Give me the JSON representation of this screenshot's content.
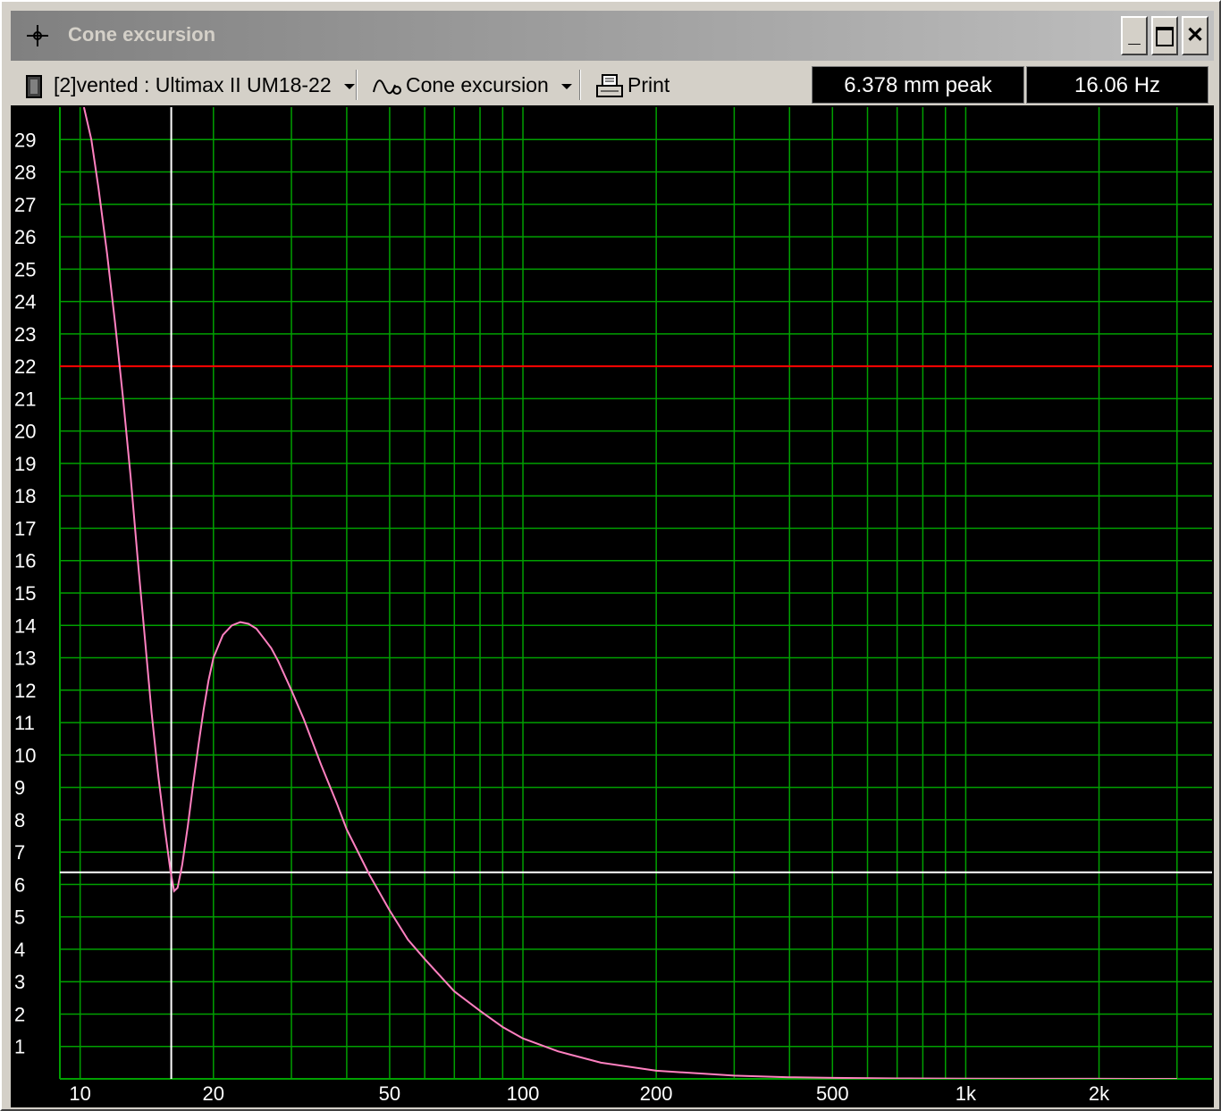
{
  "window": {
    "title": "Cone excursion",
    "icons": {
      "app": "crosshair-icon",
      "minimize": "minimize-icon",
      "maximize": "maximize-icon",
      "close": "close-icon"
    },
    "minimize_glyph": "_",
    "close_glyph": "✕"
  },
  "toolbar": {
    "project_select": {
      "value": "[2]vented : Ultimax II UM18-22",
      "icon": "speaker-icon"
    },
    "graph_select": {
      "value": "Cone excursion",
      "icon": "waveform-icon"
    },
    "print_label": "Print",
    "print_icon": "printer-icon"
  },
  "readouts": {
    "excursion": "6.378 mm peak",
    "frequency": "16.06 Hz"
  },
  "colors": {
    "grid": "#00a000",
    "curve": "#ff80c0",
    "limit_line": "#ff0000",
    "cursor": "#ffffff",
    "tick_text": "#ffffff",
    "background": "#000000"
  },
  "chart_data": {
    "type": "line",
    "x_scale": "log",
    "xlim": [
      9,
      3600
    ],
    "ylim": [
      0,
      30
    ],
    "grid": true,
    "x_tick_labels": [
      {
        "value": 10,
        "label": "10"
      },
      {
        "value": 20,
        "label": "20"
      },
      {
        "value": 50,
        "label": "50"
      },
      {
        "value": 100,
        "label": "100"
      },
      {
        "value": 200,
        "label": "200"
      },
      {
        "value": 500,
        "label": "500"
      },
      {
        "value": 1000,
        "label": "1k"
      },
      {
        "value": 2000,
        "label": "2k"
      }
    ],
    "y_ticks": [
      1,
      2,
      3,
      4,
      5,
      6,
      7,
      8,
      9,
      10,
      11,
      12,
      13,
      14,
      15,
      16,
      17,
      18,
      19,
      20,
      21,
      22,
      23,
      24,
      25,
      26,
      27,
      28,
      29
    ],
    "xmax_limit_mm": 22,
    "cursor": {
      "x": 16.06,
      "y": 6.378
    },
    "series": [
      {
        "x": [
          10.2,
          10.6,
          11.0,
          11.5,
          12.0,
          12.5,
          13.0,
          13.5,
          14.0,
          14.5,
          15.0,
          15.5,
          16.0,
          16.3,
          16.6,
          17.0,
          17.5,
          18.0,
          18.5,
          19.0,
          19.5,
          20,
          21,
          22,
          23,
          24,
          25,
          26,
          27,
          28,
          30,
          32,
          35,
          38,
          40,
          45,
          50,
          55,
          60,
          70,
          80,
          90,
          100,
          120,
          150,
          200,
          300,
          400,
          500,
          700,
          1000,
          1500,
          2000,
          3000
        ],
        "y": [
          30,
          29.0,
          27.5,
          25.5,
          23.3,
          21.0,
          18.6,
          16.0,
          13.6,
          11.3,
          9.4,
          7.8,
          6.4,
          5.8,
          5.9,
          6.6,
          7.8,
          9.1,
          10.3,
          11.4,
          12.3,
          13.0,
          13.7,
          14.0,
          14.1,
          14.05,
          13.9,
          13.6,
          13.3,
          12.9,
          12.0,
          11.1,
          9.7,
          8.5,
          7.7,
          6.3,
          5.2,
          4.3,
          3.7,
          2.7,
          2.1,
          1.6,
          1.25,
          0.85,
          0.5,
          0.25,
          0.1,
          0.05,
          0.03,
          0.015,
          0.008,
          0.004,
          0.002,
          0.001
        ]
      }
    ]
  }
}
